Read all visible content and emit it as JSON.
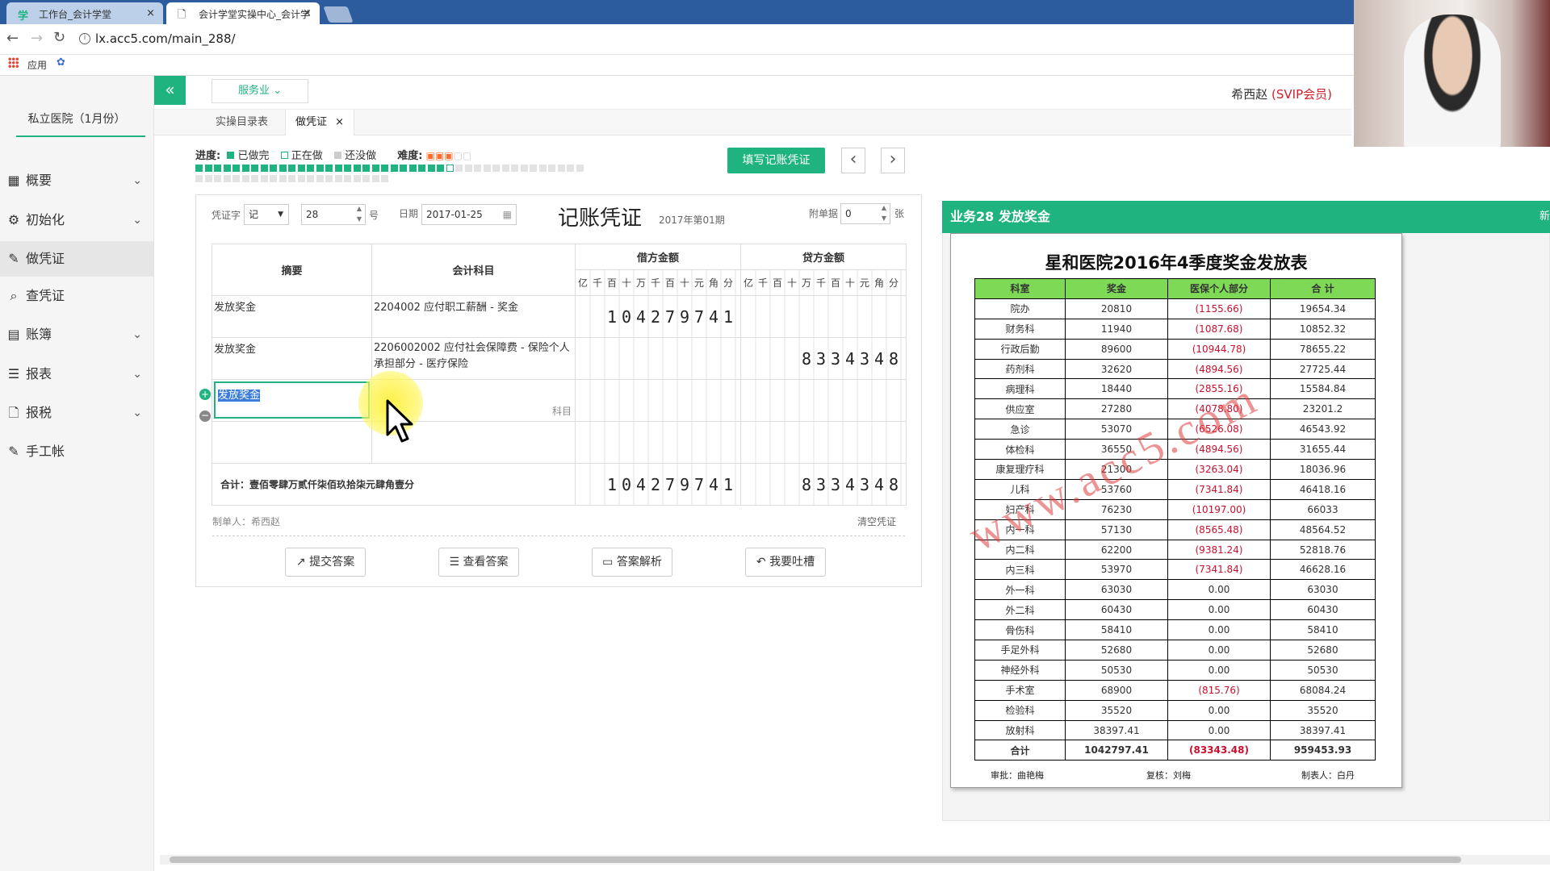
{
  "browser": {
    "tabs": [
      {
        "label": "工作台_会计学堂",
        "close": "×",
        "icon": "学"
      },
      {
        "label": "会计学堂实操中心_会计学",
        "close": "×",
        "icon": "🗋"
      }
    ],
    "address": "lx.acc5.com/main_288/",
    "bookmark_apps": "应用"
  },
  "sidebar": {
    "company": "私立医院（1月份）",
    "items": [
      {
        "label": "概要",
        "icon": "grid-icon",
        "chevron": "⌄"
      },
      {
        "label": "初始化",
        "icon": "gear-icon",
        "chevron": "⌄"
      },
      {
        "label": "做凭证",
        "icon": "pen-icon",
        "chevron": ""
      },
      {
        "label": "查凭证",
        "icon": "search-icon",
        "chevron": ""
      },
      {
        "label": "账簿",
        "icon": "book-icon",
        "chevron": "⌄"
      },
      {
        "label": "报表",
        "icon": "list-icon",
        "chevron": "⌄"
      },
      {
        "label": "报税",
        "icon": "file-icon",
        "chevron": "⌄"
      },
      {
        "label": "手工帐",
        "icon": "pen-icon",
        "chevron": ""
      }
    ]
  },
  "topnav": {
    "collapse": "«",
    "industry": "服务业",
    "user": "希西赵",
    "vip": "(SVIP会员)"
  },
  "page_tabs": [
    {
      "label": "实操目录表"
    },
    {
      "label": "做凭证",
      "close": "×"
    }
  ],
  "progress": {
    "label": "进度:",
    "done": "已做完",
    "doing": "正在做",
    "todo": "还没做",
    "difficulty": "难度:",
    "row1_done": 27,
    "row1_total": 42,
    "row2_total": 21
  },
  "actions": {
    "fill_voucher": "填写记账凭证",
    "prev": "‹",
    "next": "›"
  },
  "voucher": {
    "word_label": "凭证字",
    "word_value": "记",
    "number": "28",
    "number_unit": "号",
    "date_label": "日期",
    "date_value": "2017-01-25",
    "title": "记账凭证",
    "period": "2017年第01期",
    "attach_label": "附单据",
    "attach_value": "0",
    "attach_unit": "张",
    "headers": {
      "summary": "摘要",
      "account": "会计科目",
      "debit": "借方金额",
      "credit": "贷方金额",
      "units": [
        "亿",
        "千",
        "百",
        "十",
        "万",
        "千",
        "百",
        "十",
        "元",
        "角",
        "分"
      ]
    },
    "rows": [
      {
        "summary": "发放奖金",
        "account": "2204002 应付职工薪酬 - 奖金",
        "debit": "104279741",
        "credit": ""
      },
      {
        "summary": "发放奖金",
        "account": "2206002002 应付社会保障费 - 保险个人承担部分 - 医疗保险",
        "debit": "",
        "credit": "8334348"
      },
      {
        "summary": "发放奖金",
        "account_hint": "科目",
        "debit": "",
        "credit": ""
      },
      {
        "summary": "",
        "account": "",
        "debit": "",
        "credit": ""
      }
    ],
    "total_label": "合计：壹佰零肆万贰仟柒佰玖拾柒元肆角壹分",
    "total_debit": "104279741",
    "total_credit": "8334348",
    "maker": "制单人：希西赵",
    "clear": "清空凭证"
  },
  "bottom_buttons": [
    {
      "label": "提交答案",
      "icon": "↗"
    },
    {
      "label": "查看答案",
      "icon": "☰"
    },
    {
      "label": "答案解析",
      "icon": "▭"
    },
    {
      "label": "我要吐槽",
      "icon": "↶"
    }
  ],
  "business": {
    "title": "业务28 发放奖金",
    "extra": "新"
  },
  "bonus_table": {
    "title": "星和医院2016年4季度奖金发放表",
    "headers": [
      "科室",
      "奖金",
      "医保个人部分",
      "合 计"
    ],
    "rows": [
      [
        "院办",
        "20810",
        "(1155.66)",
        "19654.34"
      ],
      [
        "财务科",
        "11940",
        "(1087.68)",
        "10852.32"
      ],
      [
        "行政后勤",
        "89600",
        "(10944.78)",
        "78655.22"
      ],
      [
        "药剂科",
        "32620",
        "(4894.56)",
        "27725.44"
      ],
      [
        "病理科",
        "18440",
        "(2855.16)",
        "15584.84"
      ],
      [
        "供应室",
        "27280",
        "(4078.80)",
        "23201.2"
      ],
      [
        "急诊",
        "53070",
        "(6526.08)",
        "46543.92"
      ],
      [
        "体检科",
        "36550",
        "(4894.56)",
        "31655.44"
      ],
      [
        "康复理疗科",
        "21300",
        "(3263.04)",
        "18036.96"
      ],
      [
        "儿科",
        "53760",
        "(7341.84)",
        "46418.16"
      ],
      [
        "妇产科",
        "76230",
        "(10197.00)",
        "66033"
      ],
      [
        "内一科",
        "57130",
        "(8565.48)",
        "48564.52"
      ],
      [
        "内二科",
        "62200",
        "(9381.24)",
        "52818.76"
      ],
      [
        "内三科",
        "53970",
        "(7341.84)",
        "46628.16"
      ],
      [
        "外一科",
        "63030",
        "0.00",
        "63030"
      ],
      [
        "外二科",
        "60430",
        "0.00",
        "60430"
      ],
      [
        "骨伤科",
        "58410",
        "0.00",
        "58410"
      ],
      [
        "手足外科",
        "52680",
        "0.00",
        "52680"
      ],
      [
        "神经外科",
        "50530",
        "0.00",
        "50530"
      ],
      [
        "手术室",
        "68900",
        "(815.76)",
        "68084.24"
      ],
      [
        "检验科",
        "35520",
        "0.00",
        "35520"
      ],
      [
        "放射科",
        "38397.41",
        "0.00",
        "38397.41"
      ]
    ],
    "total": [
      "合计",
      "1042797.41",
      "(83343.48)",
      "959453.93"
    ],
    "footer": [
      "审批：曲艳梅",
      "复核：刘梅",
      "制表人：白丹"
    ],
    "watermark": "www.acc5.com"
  },
  "colors": {
    "accent": "#1fb37f",
    "vip": "#d0202c",
    "header_green": "#7ed957",
    "negative": "#c8102e"
  }
}
